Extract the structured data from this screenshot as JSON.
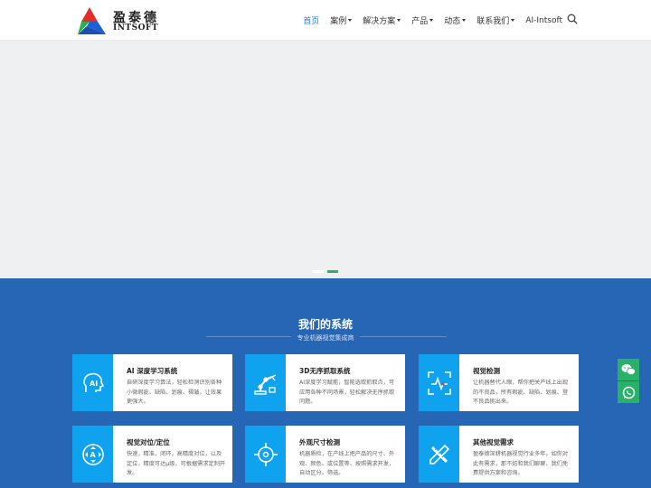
{
  "logo": {
    "cn": "盈泰德",
    "en": "INTSOFT"
  },
  "nav": {
    "items": [
      {
        "label": "首页",
        "dropdown": false,
        "active": true
      },
      {
        "label": "案例",
        "dropdown": true,
        "active": false
      },
      {
        "label": "解决方案",
        "dropdown": true,
        "active": false
      },
      {
        "label": "产品",
        "dropdown": true,
        "active": false
      },
      {
        "label": "动态",
        "dropdown": true,
        "active": false
      },
      {
        "label": "联系我们",
        "dropdown": true,
        "active": false
      },
      {
        "label": "AI-Intsoft",
        "dropdown": false,
        "active": false
      }
    ],
    "search_icon": "search-icon"
  },
  "banner": {
    "slides": 2,
    "active_slide": 2
  },
  "systems": {
    "title": "我们的系统",
    "subtitle": "专业机器视觉集成商",
    "cards": [
      {
        "icon": "ai-head-icon",
        "title": "AI 深度学习系统",
        "desc": "自研深度学习算法，轻松检测识别各种小微瑕疵、缺陷、划痕、褶皱，让效果更强大。"
      },
      {
        "icon": "robot-arm-icon",
        "title": "3D无序抓取系统",
        "desc": "AI深度学习赋能，智能选取抓取点，可应用各种不同场景，轻松解决无序抓取问题。"
      },
      {
        "icon": "vision-check-icon",
        "title": "视觉检测",
        "desc": "让机器替代人眼，帮你把关产线上出现的不良品，所有瑕疵、缺陷、划痕、登不良品挑出来。"
      },
      {
        "icon": "positioning-icon",
        "title": "视觉对位/定位",
        "desc": "快速，精准，闭环，高精度对位，以及定位，精度可达μ级，可根据需求定制开发。"
      },
      {
        "icon": "measure-icon",
        "title": "外观尺寸检测",
        "desc": "机器质检，在产线上把产品的尺寸、外观、颜色、或位置等、按照需求开发，自动区分、筛选。"
      },
      {
        "icon": "pencil-ruler-icon",
        "title": "其他视觉需求",
        "desc": "盈泰德深耕机器视觉行业多年，如你对此有需求，那不妨和我们聊聊，我们免费提供方案和咨询。"
      }
    ]
  },
  "side": {
    "items": [
      "wechat-icon",
      "whatsapp-icon"
    ]
  },
  "colors": {
    "accent": "#2a7ad9",
    "section_bg": "#2766b4",
    "card_icon_bg": "#0ea2ef",
    "green": "#2ab169"
  }
}
